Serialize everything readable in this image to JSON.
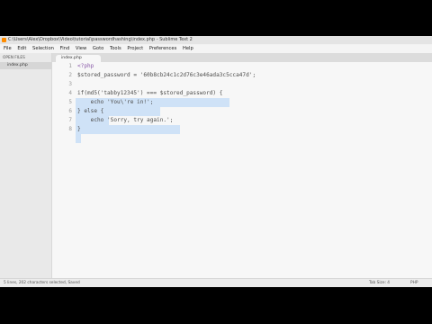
{
  "window": {
    "title": "C:\\Users\\Alex\\Dropbox\\Video\\tutorial\\passwordhashing\\index.php - Sublime Text 2"
  },
  "menu": [
    "File",
    "Edit",
    "Selection",
    "Find",
    "View",
    "Goto",
    "Tools",
    "Project",
    "Preferences",
    "Help"
  ],
  "sidebar": {
    "header": "OPEN FILES",
    "open_file": "index.php"
  },
  "tab": {
    "label": "index.php"
  },
  "lines": [
    {
      "n": "1",
      "text": "<?php"
    },
    {
      "n": "2",
      "text": "$stored_password = '60b8cb24c1c2d76c3e46ada3c5cca47d';"
    },
    {
      "n": "3",
      "text": ""
    },
    {
      "n": "4",
      "text": "if(md5('tabby12345') === $stored_password) {"
    },
    {
      "n": "5",
      "text": "    echo 'You\\'re in!';"
    },
    {
      "n": "6",
      "text": "} else {"
    },
    {
      "n": "7",
      "text": "    echo 'Sorry, try again.';"
    },
    {
      "n": "8",
      "text": "}"
    }
  ],
  "status": {
    "left": "5 lines, 202 characters selected, Saved",
    "tab_size": "Tab Size: 4",
    "syntax": "PHP"
  },
  "colors": {
    "accent": "#ff8c00",
    "selection": "#cfe2f7"
  }
}
